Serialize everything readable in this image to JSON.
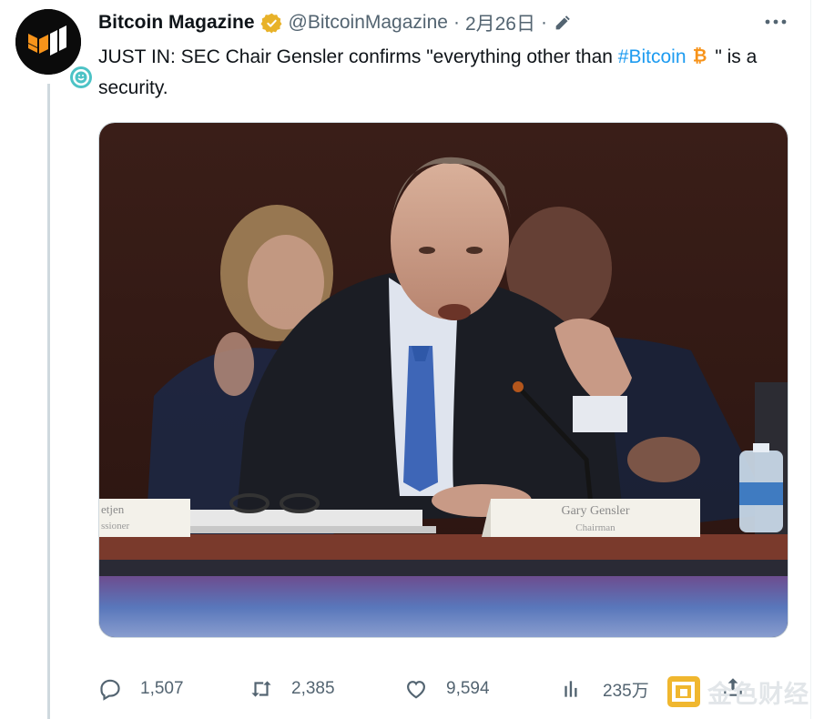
{
  "author": {
    "display_name": "Bitcoin Magazine",
    "handle": "@BitcoinMagazine",
    "separator": "·",
    "date": "2月26日",
    "more_icon": "more-horizontal-icon",
    "verified_color": "#e8b229"
  },
  "tweet": {
    "text_before": "JUST IN: SEC Chair Gensler confirms \"everything other than ",
    "hashtag": "#Bitcoin",
    "text_after": " \" is a security.",
    "emoji": "bitcoin-emoji",
    "hashtag_color": "#1d9bf0"
  },
  "media": {
    "nameplate_main": "Gary Gensler",
    "nameplate_sub": "Chairman",
    "nameplate_left_top": "etjen",
    "nameplate_left_bottom": "ssioner"
  },
  "actions": {
    "replies": "1,507",
    "retweets": "2,385",
    "likes": "9,594",
    "views": "235万"
  },
  "watermark": {
    "text": "金色财经"
  }
}
